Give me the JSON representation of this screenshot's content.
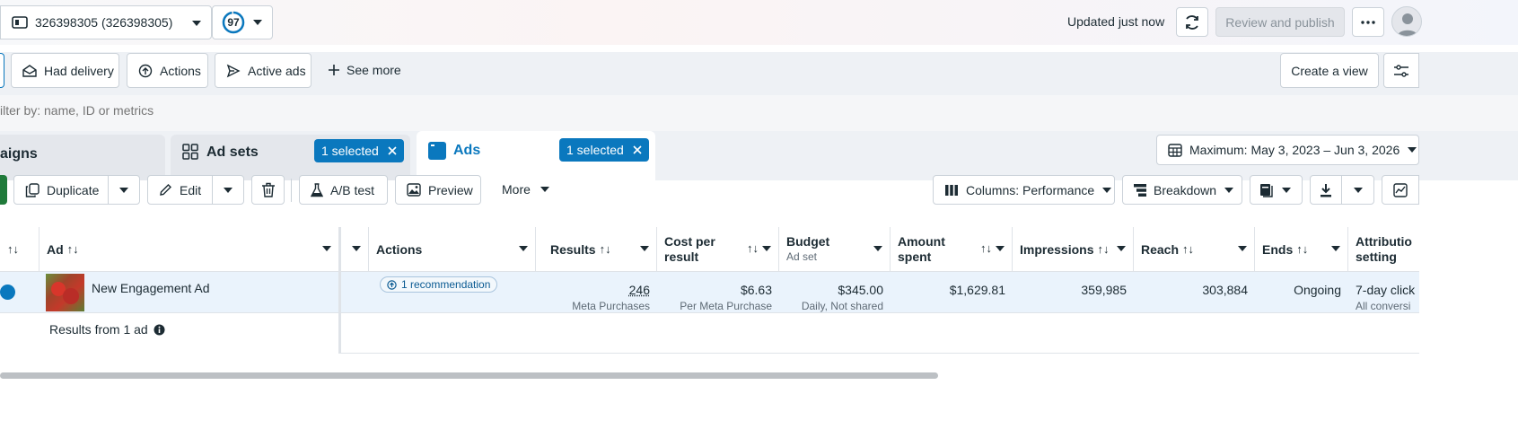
{
  "topbar": {
    "account_label": "326398305 (326398305)",
    "score": "97",
    "updated_text": "Updated just now",
    "review_label": "Review and publish"
  },
  "filters": {
    "items": [
      "Had delivery",
      "Actions",
      "Active ads"
    ],
    "see_more": "See more",
    "create_view": "Create a view"
  },
  "search": {
    "placeholder": "ilter by: name, ID or metrics"
  },
  "tabs": {
    "campaigns": "aigns",
    "adsets": "Ad sets",
    "adsets_selected": "1 selected",
    "ads": "Ads",
    "ads_selected": "1 selected",
    "date_range": "Maximum: May 3, 2023 – Jun 3, 2026"
  },
  "toolbar": {
    "duplicate": "Duplicate",
    "edit": "Edit",
    "ab_test": "A/B test",
    "preview": "Preview",
    "more": "More",
    "columns": "Columns: Performance",
    "breakdown": "Breakdown"
  },
  "table": {
    "headers": {
      "ad": "Ad",
      "actions": "Actions",
      "results": "Results",
      "cost_line1": "Cost per",
      "cost_line2": "result",
      "budget": "Budget",
      "budget_sub": "Ad set",
      "amount_line1": "Amount",
      "amount_line2": "spent",
      "impressions": "Impressions",
      "reach": "Reach",
      "ends": "Ends",
      "attr_line1": "Attributio",
      "attr_line2": "setting"
    },
    "row": {
      "ad_name": "New Engagement Ad",
      "recommendation": "1 recommendation",
      "results": "246",
      "results_sub": "Meta Purchases",
      "cost": "$6.63",
      "cost_sub": "Per Meta Purchase",
      "budget": "$345.00",
      "budget_sub": "Daily, Not shared",
      "amount": "$1,629.81",
      "impressions": "359,985",
      "reach": "303,884",
      "ends": "Ongoing",
      "attr": "7-day click",
      "attr_sub": "All conversi"
    },
    "summary": "Results from 1 ad"
  },
  "colors": {
    "accent": "#0a78be",
    "row_selected": "#eaf3fc",
    "border": "#cbd2d9"
  }
}
